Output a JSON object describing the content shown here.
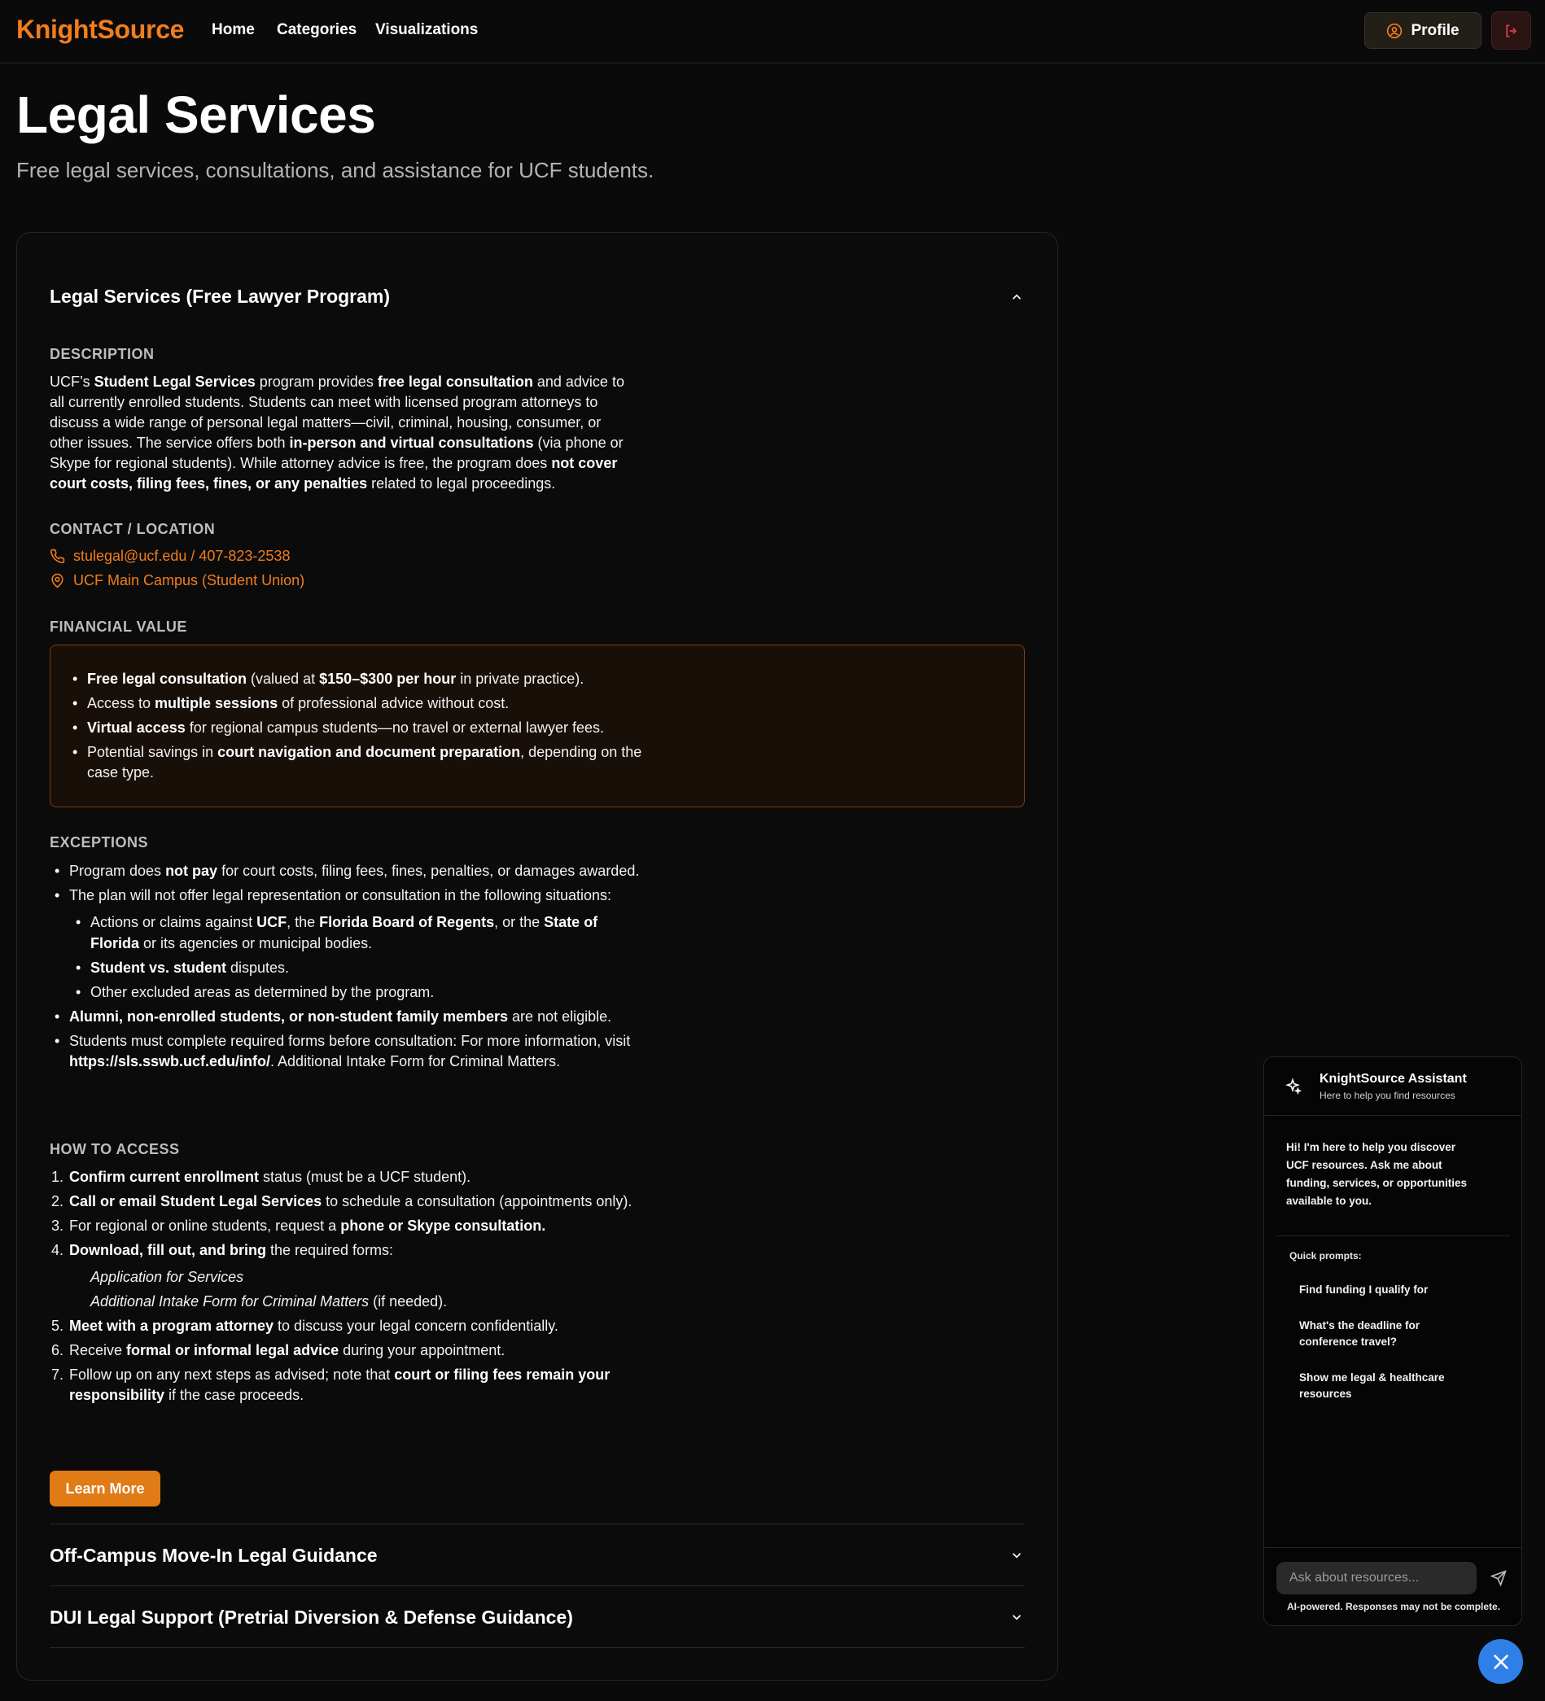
{
  "header": {
    "logo": "KnightSource",
    "nav": [
      "Home",
      "Categories",
      "Visualizations"
    ],
    "profile_label": "Profile",
    "profile_icon": "user-circle-icon",
    "logout_icon": "logout-icon",
    "brand_color": "#f07d1d"
  },
  "page": {
    "title": "Legal Services",
    "subtitle": "Free legal services, consultations, and assistance for UCF students."
  },
  "resource": {
    "title": "Legal Services (Free Lawyer Program)",
    "description_label": "DESCRIPTION",
    "contact_label": "CONTACT / LOCATION",
    "contact_phone_email": "stulegal@ucf.edu / 407-823-2538",
    "contact_location": "UCF Main Campus (Student Union)",
    "financial_label": "FINANCIAL VALUE",
    "exceptions_label": "EXCEPTIONS",
    "access_label": "HOW TO ACCESS",
    "learn_more": "Learn More"
  },
  "accordion": [
    {
      "title": "Off-Campus Move-In Legal Guidance"
    },
    {
      "title": "DUI Legal Support (Pretrial Diversion & Defense Guidance)"
    }
  ],
  "chat": {
    "title": "KnightSource Assistant",
    "subtitle": "Here to help you find resources",
    "greeting": "Hi! I'm here to help you discover UCF resources. Ask me about funding, services, or opportunities available to you.",
    "quick_label": "Quick prompts:",
    "prompts": [
      "Find funding I qualify for",
      "What's the deadline for conference travel?",
      "Show me legal & healthcare resources"
    ],
    "input_placeholder": "Ask about resources...",
    "disclaimer": "AI-powered. Responses may not be complete.",
    "accent": "#2f7fe8"
  }
}
